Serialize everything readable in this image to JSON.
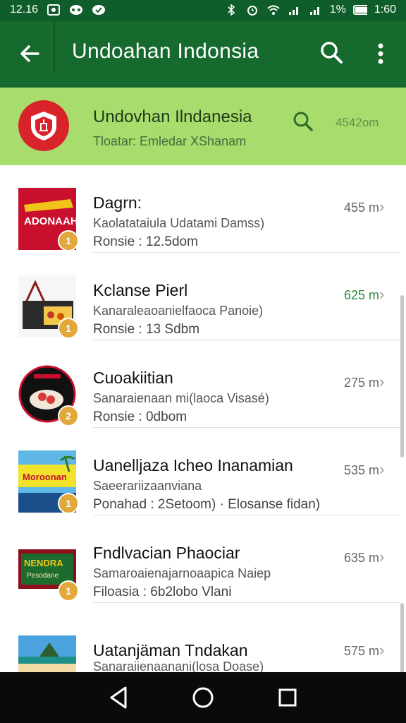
{
  "status": {
    "time": "12.16",
    "left_icons": [
      "photo-icon",
      "image-icon",
      "whatsapp-icon",
      "chat-icon"
    ],
    "battery_pct": "1%",
    "right_text": "1%",
    "clock_right": "1:60"
  },
  "appbar": {
    "title": "Undoahan Indonsia"
  },
  "header": {
    "name": "Undovhan Ilndanesia",
    "subtitle": "Tloatar: Emledar XShanam",
    "distance": "4542om"
  },
  "items": [
    {
      "name": "Dagrn:",
      "line2": "Kaolatataiula Udatami Damss)",
      "line3": "Ronsie : 12.5dom",
      "distance": "455 m",
      "badge": "1",
      "distance_color": "#666666"
    },
    {
      "name": "Kclanse Pierl",
      "line2": "Kanaraleaoanielfaoca Panoie)",
      "line3": "Ronsie : 13 Sdbm",
      "distance": "625 m",
      "badge": "1",
      "distance_color": "#2e8b3a"
    },
    {
      "name": "Cuoakiitian",
      "line2": "Sanaraienaan mi(laoca Visasé)",
      "line3": "Ronsie : 0dbom",
      "distance": "275 m",
      "badge": "2",
      "distance_color": "#666666"
    },
    {
      "name": "Uanelljaza Icheo Inanamian",
      "line2": "Saeerariizaanviana",
      "line3": "Ponahad : 2Setoom) · Elosanse fidan)",
      "distance": "535 m",
      "badge": "1",
      "distance_color": "#666666"
    },
    {
      "name": "Fndlvacian Phaociar",
      "line2": "Samaroaienajarnoaapica Naiep",
      "line3": "Filoasia : 6b2lobo    Vlani",
      "distance": "635 m",
      "badge": "1",
      "distance_color": "#666666"
    },
    {
      "name": "Uatanjäman Tndakan",
      "line2": "Sanaraiienaanani(losa Doase)",
      "line3": "",
      "distance": "575 m",
      "badge": "",
      "distance_color": "#666666"
    }
  ]
}
